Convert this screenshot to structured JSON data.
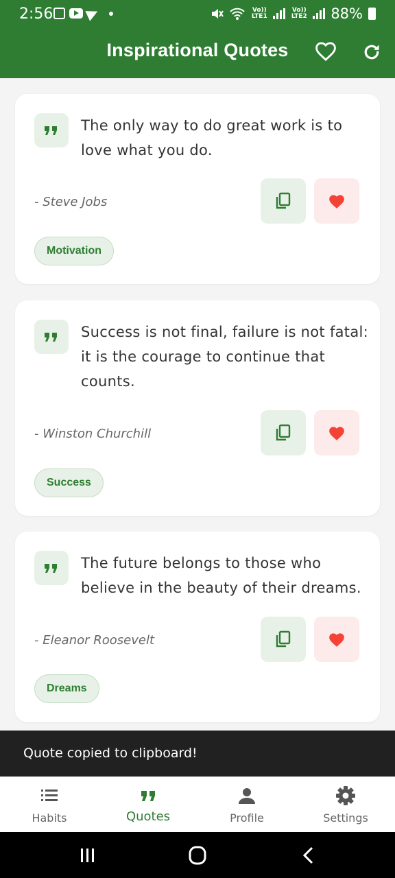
{
  "status_bar": {
    "time": "2:56",
    "network_1": "Vo)) LTE1",
    "network_2": "Vo)) LTE2",
    "battery": "88%"
  },
  "app_bar": {
    "title": "Inspirational Quotes",
    "favorites_icon": "heart-outline-icon",
    "refresh_icon": "refresh-icon"
  },
  "quotes": [
    {
      "text": "The only way to do great work is to love what you do.",
      "author": "- Steve Jobs",
      "tag": "Motivation"
    },
    {
      "text": "Success is not final, failure is not fatal: it is the courage to continue that counts.",
      "author": "- Winston Churchill",
      "tag": "Success"
    },
    {
      "text": "The future belongs to those who believe in the beauty of their dreams.",
      "author": "- Eleanor Roosevelt",
      "tag": "Dreams"
    }
  ],
  "snackbar": {
    "message": "Quote copied to clipboard!"
  },
  "bottom_nav": {
    "items": [
      {
        "label": "Habits",
        "icon": "list-icon",
        "active": false
      },
      {
        "label": "Quotes",
        "icon": "quote-icon",
        "active": true
      },
      {
        "label": "Profile",
        "icon": "person-icon",
        "active": false
      },
      {
        "label": "Settings",
        "icon": "gear-icon",
        "active": false
      }
    ]
  },
  "colors": {
    "primary": "#2e7d32",
    "tag_background": "#e8f1e7",
    "favorite_background": "#fdeaea",
    "favorite": "#f44336",
    "snackbar": "#212121"
  }
}
